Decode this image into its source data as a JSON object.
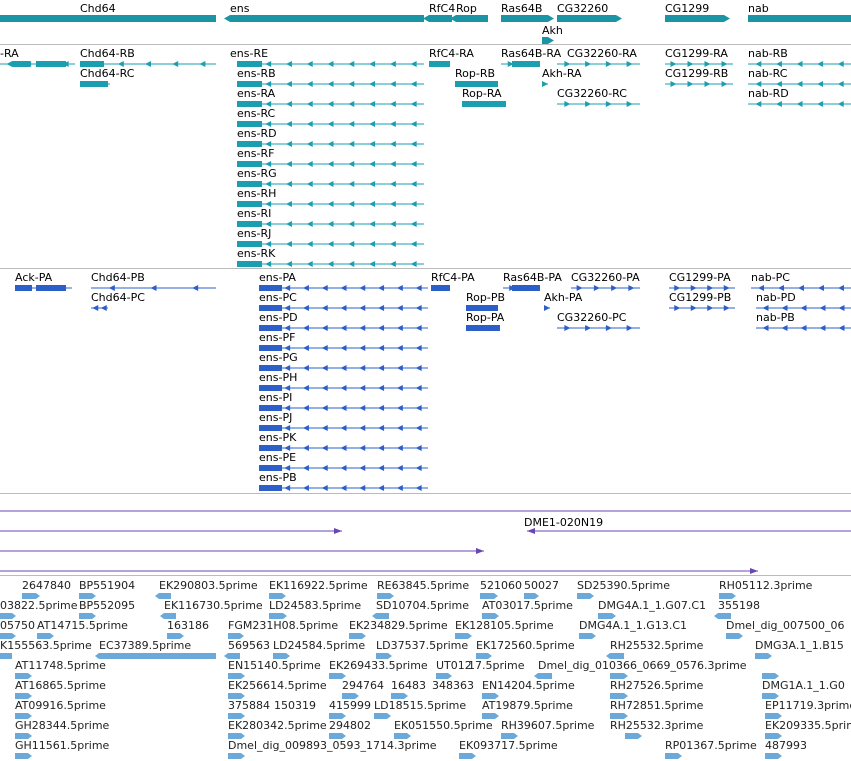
{
  "colors": {
    "gene": "#1b95a5",
    "transcript": "#1b9fb0",
    "cds": "#2c5fc8",
    "bac": "#6a45b5",
    "est": "#6aa9d9"
  },
  "track_gene": {
    "labels": [
      "Chd64",
      "ens",
      "RfC4",
      "Rop",
      "Ras64B",
      "CG32260",
      "CG1299",
      "nab",
      "Akh"
    ]
  },
  "track_transcripts": {
    "labels": [
      "-RA",
      "Chd64-RB",
      "Chd64-RC",
      "ens-RE",
      "ens-RB",
      "ens-RA",
      "ens-RC",
      "ens-RD",
      "ens-RF",
      "ens-RG",
      "ens-RH",
      "ens-RI",
      "ens-RJ",
      "ens-RK",
      "RfC4-RA",
      "Ras64B-RA",
      "CG32260-RA",
      "CG1299-RA",
      "nab-RB",
      "Rop-RB",
      "Rop-RA",
      "Akh-RA",
      "CG32260-RC",
      "CG1299-RB",
      "nab-RC",
      "nab-RD"
    ]
  },
  "track_cds": {
    "labels": [
      "Ack-PA",
      "Chd64-PB",
      "Chd64-PC",
      "ens-PA",
      "ens-PC",
      "ens-PD",
      "ens-PF",
      "ens-PG",
      "ens-PH",
      "ens-PI",
      "ens-PJ",
      "ens-PK",
      "ens-PE",
      "ens-PB",
      "RfC4-PA",
      "Ras64B-PA",
      "CG32260-PA",
      "CG1299-PA",
      "nab-PC",
      "Rop-PB",
      "Rop-PA",
      "Akh-PA",
      "CG32260-PC",
      "CG1299-PB",
      "nab-PD",
      "nab-PB"
    ]
  },
  "track_bac": {
    "labels": [
      "DME1-020N19"
    ]
  },
  "track_est": {
    "labels": [
      "2647840",
      "BP551904",
      "EK290803.5prime",
      "EK116922.5prime",
      "RE63845.5prime",
      "521060",
      "50027",
      "SD25390.5prime",
      "RH05112.3prime",
      "03822.5prime",
      "BP552095",
      "EK116730.5prime",
      "LD24583.5prime",
      "SD10704.5prime",
      "AT03017.5prime",
      "DMG4A.1_1.G07.C1",
      "355198",
      "05750",
      "AT14715.5prime",
      "163186",
      "FGM231H08.5prime",
      "EK234829.5prime",
      "EK128105.5prime",
      "DMG4A.1_1.G13.C1",
      "Dmel_dig_007500_06",
      "K155563.5prime",
      "EC37389.5prime",
      "569563",
      "LD24584.5prime",
      "LD37537.5prime",
      "EK172560.5prime",
      "RH25532.5prime",
      "DMG3A.1_1.B15",
      "AT11748.5prime",
      "EN15140.5prime",
      "EK269433.5prime",
      "UT012",
      "17.5prime",
      "Dmel_dig_010366_0669_0576.3prime",
      "AT16865.5prime",
      "EK256614.5prime",
      "294764",
      "16483",
      "348363",
      "EN14204.5prime",
      "RH27526.5prime",
      "DMG1A.1_1.G0",
      "AT09916.5prime",
      "375884",
      "150319",
      "415999",
      "LD18515.5prime",
      "AT19879.5prime",
      "RH72851.5prime",
      "EP11719.3prime",
      "GH28344.5prime",
      "EK280342.5prime",
      "294802",
      "EK051550.5prime",
      "RH39607.5prime",
      "RH25532.3prime",
      "EK209335.5prime",
      "GH11561.5prime",
      "Dmel_dig_009893_0593_1714.3prime",
      "EK093717.5prime",
      "RP01367.5prime",
      "487993"
    ]
  }
}
